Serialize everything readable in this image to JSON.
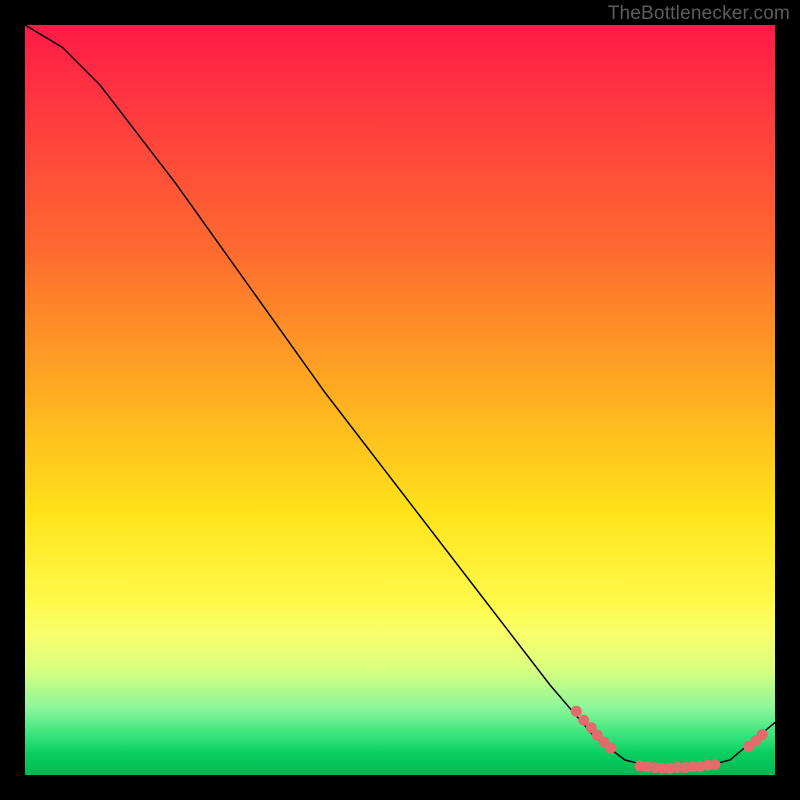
{
  "watermark": "TheBottlenecker.com",
  "chart_data": {
    "type": "line",
    "title": "",
    "xlabel": "",
    "ylabel": "",
    "xlim": [
      0,
      100
    ],
    "ylim": [
      0,
      100
    ],
    "curve": [
      {
        "x": 0,
        "y": 100
      },
      {
        "x": 5,
        "y": 97
      },
      {
        "x": 10,
        "y": 92
      },
      {
        "x": 20,
        "y": 79
      },
      {
        "x": 30,
        "y": 65
      },
      {
        "x": 40,
        "y": 51
      },
      {
        "x": 50,
        "y": 38
      },
      {
        "x": 60,
        "y": 25
      },
      {
        "x": 70,
        "y": 12
      },
      {
        "x": 76,
        "y": 5
      },
      {
        "x": 80,
        "y": 2
      },
      {
        "x": 84,
        "y": 1
      },
      {
        "x": 90,
        "y": 1
      },
      {
        "x": 94,
        "y": 2
      },
      {
        "x": 100,
        "y": 7
      }
    ],
    "points_descending": [
      {
        "x": 73.5,
        "y": 8.5
      },
      {
        "x": 74.5,
        "y": 7.3
      },
      {
        "x": 75.5,
        "y": 6.3
      },
      {
        "x": 76.3,
        "y": 5.3
      },
      {
        "x": 77.2,
        "y": 4.4
      },
      {
        "x": 78.1,
        "y": 3.6
      }
    ],
    "points_bottom": [
      {
        "x": 82.0,
        "y": 1.2
      },
      {
        "x": 83.0,
        "y": 1.1
      },
      {
        "x": 84.0,
        "y": 1.0
      },
      {
        "x": 85.0,
        "y": 0.9
      },
      {
        "x": 86.0,
        "y": 0.9
      },
      {
        "x": 87.0,
        "y": 1.0
      },
      {
        "x": 88.0,
        "y": 1.0
      },
      {
        "x": 89.0,
        "y": 1.1
      },
      {
        "x": 90.0,
        "y": 1.1
      },
      {
        "x": 91.0,
        "y": 1.3
      },
      {
        "x": 92.0,
        "y": 1.4
      }
    ],
    "points_ascending": [
      {
        "x": 96.5,
        "y": 3.8
      },
      {
        "x": 97.5,
        "y": 4.6
      },
      {
        "x": 98.3,
        "y": 5.4
      }
    ],
    "point_color": "#e46b6b",
    "point_radius": 5.5,
    "line_color": "#000000",
    "line_width": 1.5
  }
}
